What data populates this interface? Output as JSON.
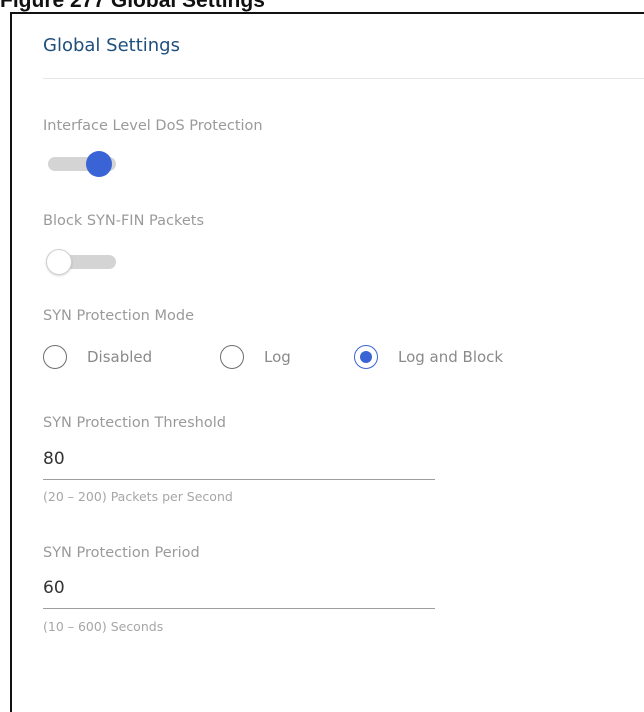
{
  "figure_caption": "Figure 277   Global Settings",
  "panel": {
    "title": "Global Settings"
  },
  "interface_dos": {
    "label": "Interface Level DoS Protection",
    "enabled": true
  },
  "block_syn_fin": {
    "label": "Block SYN-FIN Packets",
    "enabled": false
  },
  "syn_mode": {
    "label": "SYN Protection Mode",
    "options": [
      {
        "label": "Disabled",
        "checked": false
      },
      {
        "label": "Log",
        "checked": false
      },
      {
        "label": "Log and Block",
        "checked": true
      }
    ]
  },
  "syn_threshold": {
    "label": "SYN Protection Threshold",
    "value": "80",
    "helper": "(20 – 200) Packets per Second"
  },
  "syn_period": {
    "label": "SYN Protection Period",
    "value": "60",
    "helper": "(10 – 600) Seconds"
  },
  "colors": {
    "accent": "#3a63d6",
    "title": "#1f4f7c",
    "label": "#9a9a9a"
  }
}
